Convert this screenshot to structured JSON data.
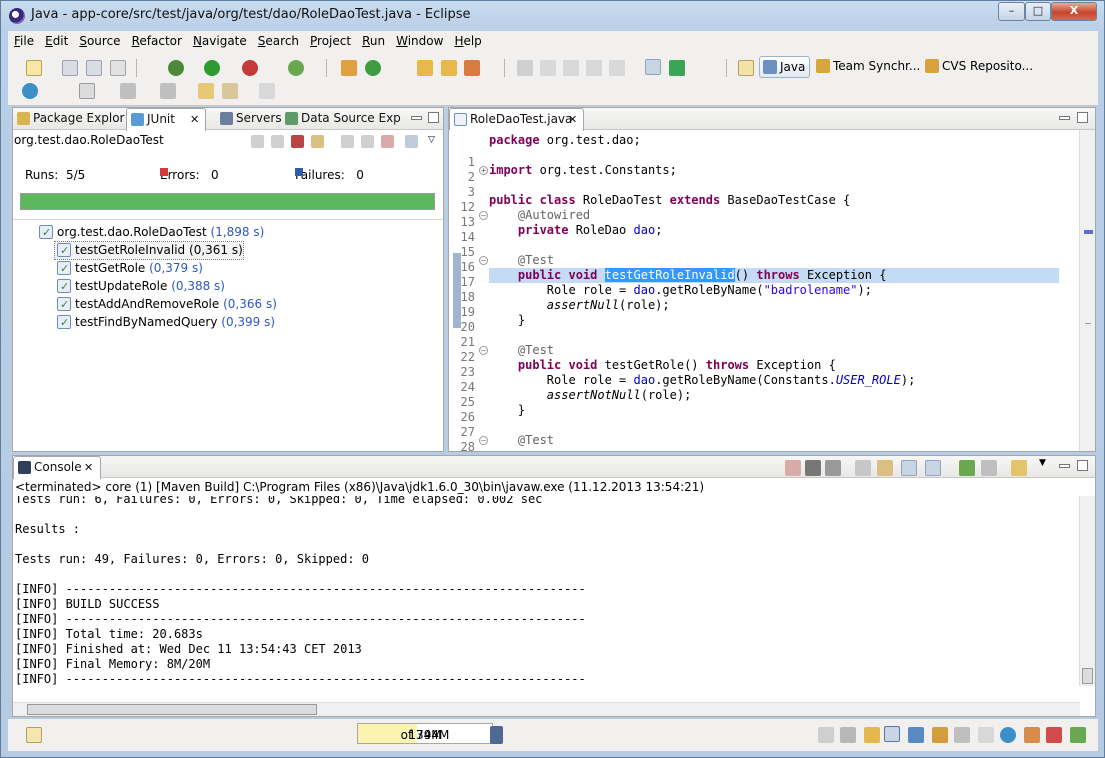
{
  "window": {
    "title": "Java - app-core/src/test/java/org/test/dao/RoleDaoTest.java - Eclipse",
    "minimize": "–",
    "maximize": "□",
    "close": "X"
  },
  "menu": [
    "File",
    "Edit",
    "Source",
    "Refactor",
    "Navigate",
    "Search",
    "Project",
    "Run",
    "Window",
    "Help"
  ],
  "perspectives": [
    {
      "label": "Java",
      "active": true,
      "icon": "java-perspective-icon"
    },
    {
      "label": "Team Synchr...",
      "active": false,
      "icon": "team-sync-icon"
    },
    {
      "label": "CVS Reposito...",
      "active": false,
      "icon": "cvs-repo-icon"
    }
  ],
  "left_panel": {
    "tabs": [
      {
        "label": "Package Explor",
        "icon": "package-explorer-icon"
      },
      {
        "label": "JUnit",
        "icon": "junit-icon",
        "selected": true
      },
      {
        "label": "Servers",
        "icon": "servers-icon"
      },
      {
        "label": "Data Source Exp",
        "icon": "data-source-icon"
      }
    ],
    "suite_name": "org.test.dao.RoleDaoTest",
    "runs_label": "Runs:",
    "runs_value": "5/5",
    "errors_label": "Errors:",
    "errors_value": "0",
    "failures_label": "Failures:",
    "failures_value": "0",
    "progress": 1.0,
    "progress_color": "#5cb85c",
    "tree": {
      "root": {
        "label": "org.test.dao.RoleDaoTest",
        "time": "(1,898 s)"
      },
      "children": [
        {
          "label": "testGetRoleInvalid",
          "time": "(0,361 s)",
          "selected": true
        },
        {
          "label": "testGetRole",
          "time": "(0,379 s)"
        },
        {
          "label": "testUpdateRole",
          "time": "(0,388 s)"
        },
        {
          "label": "testAddAndRemoveRole",
          "time": "(0,366 s)"
        },
        {
          "label": "testFindByNamedQuery",
          "time": "(0,399 s)"
        }
      ]
    }
  },
  "editor": {
    "tab_label": "RoleDaoTest.java",
    "lines": [
      {
        "n": "1",
        "fold": "",
        "segs": [
          [
            "kw",
            "package"
          ],
          [
            "",
            " org.test.dao;"
          ]
        ]
      },
      {
        "n": "2",
        "fold": "",
        "segs": []
      },
      {
        "n": "3",
        "fold": "plus",
        "segs": [
          [
            "kw",
            "import"
          ],
          [
            "",
            " org.test.Constants;"
          ]
        ]
      },
      {
        "n": "12",
        "fold": "",
        "segs": []
      },
      {
        "n": "13",
        "fold": "",
        "segs": [
          [
            "kw",
            "public class"
          ],
          [
            "",
            " RoleDaoTest "
          ],
          [
            "kw",
            "extends"
          ],
          [
            "",
            " BaseDaoTestCase {"
          ]
        ]
      },
      {
        "n": "14",
        "fold": "minus",
        "segs": [
          [
            "",
            "    "
          ],
          [
            "ann",
            "@Autowired"
          ]
        ]
      },
      {
        "n": "15",
        "fold": "",
        "segs": [
          [
            "",
            "    "
          ],
          [
            "kw",
            "private"
          ],
          [
            "",
            " RoleDao "
          ],
          [
            "fld",
            "dao"
          ],
          [
            "",
            ";"
          ]
        ]
      },
      {
        "n": "16",
        "fold": "",
        "segs": []
      },
      {
        "n": "17",
        "fold": "minus",
        "segs": [
          [
            "",
            "    "
          ],
          [
            "ann",
            "@Test"
          ]
        ]
      },
      {
        "n": "18",
        "fold": "",
        "hl": true,
        "segs": [
          [
            "",
            "    "
          ],
          [
            "kw",
            "public void"
          ],
          [
            "",
            " "
          ],
          [
            "sel-word",
            "testGetRoleInvalid"
          ],
          [
            "",
            "() "
          ],
          [
            "kw",
            "throws"
          ],
          [
            "",
            " Exception {"
          ]
        ]
      },
      {
        "n": "19",
        "fold": "",
        "segs": [
          [
            "",
            "        Role role = "
          ],
          [
            "fld",
            "dao"
          ],
          [
            "",
            ".getRoleByName("
          ],
          [
            "str",
            "\"badrolename\""
          ],
          [
            "",
            ");"
          ]
        ]
      },
      {
        "n": "20",
        "fold": "",
        "segs": [
          [
            "",
            "        "
          ],
          [
            "ital",
            "assertNull"
          ],
          [
            "",
            "(role);"
          ]
        ]
      },
      {
        "n": "21",
        "fold": "",
        "segs": [
          [
            "",
            "    }"
          ]
        ]
      },
      {
        "n": "22",
        "fold": "",
        "segs": []
      },
      {
        "n": "23",
        "fold": "minus",
        "segs": [
          [
            "",
            "    "
          ],
          [
            "ann",
            "@Test"
          ]
        ]
      },
      {
        "n": "24",
        "fold": "",
        "segs": [
          [
            "",
            "    "
          ],
          [
            "kw",
            "public void"
          ],
          [
            "",
            " testGetRole() "
          ],
          [
            "kw",
            "throws"
          ],
          [
            "",
            " Exception {"
          ]
        ]
      },
      {
        "n": "25",
        "fold": "",
        "segs": [
          [
            "",
            "        Role role = "
          ],
          [
            "fld",
            "dao"
          ],
          [
            "",
            ".getRoleByName(Constants."
          ],
          [
            "stat",
            "USER_ROLE"
          ],
          [
            "",
            ");"
          ]
        ]
      },
      {
        "n": "26",
        "fold": "",
        "segs": [
          [
            "",
            "        "
          ],
          [
            "ital",
            "assertNotNull"
          ],
          [
            "",
            "(role);"
          ]
        ]
      },
      {
        "n": "27",
        "fold": "",
        "segs": [
          [
            "",
            "    }"
          ]
        ]
      },
      {
        "n": "28",
        "fold": "",
        "segs": []
      },
      {
        "n": "29",
        "fold": "minus",
        "segs": [
          [
            "",
            "    "
          ],
          [
            "ann",
            "@Test"
          ]
        ]
      }
    ]
  },
  "console": {
    "tab_label": "Console",
    "header": "<terminated> core (1) [Maven Build] C:\\Program Files (x86)\\Java\\jdk1.6.0_30\\bin\\javaw.exe (11.12.2013 13:54:21)",
    "lines": [
      "Tests run: 6, Failures: 0, Errors: 0, Skipped: 0, Time elapsed: 0.002 sec",
      "",
      "Results :",
      "",
      "Tests run: 49, Failures: 0, Errors: 0, Skipped: 0",
      "",
      "[INFO] ------------------------------------------------------------------------",
      "[INFO] BUILD SUCCESS",
      "[INFO] ------------------------------------------------------------------------",
      "[INFO] Total time: 20.683s",
      "[INFO] Finished at: Wed Dec 11 13:54:43 CET 2013",
      "[INFO] Final Memory: 8M/20M",
      "[INFO] ------------------------------------------------------------------------"
    ]
  },
  "status": {
    "heap_used": "174M",
    "heap_total": "of 394M",
    "heap_fraction": 0.44
  }
}
